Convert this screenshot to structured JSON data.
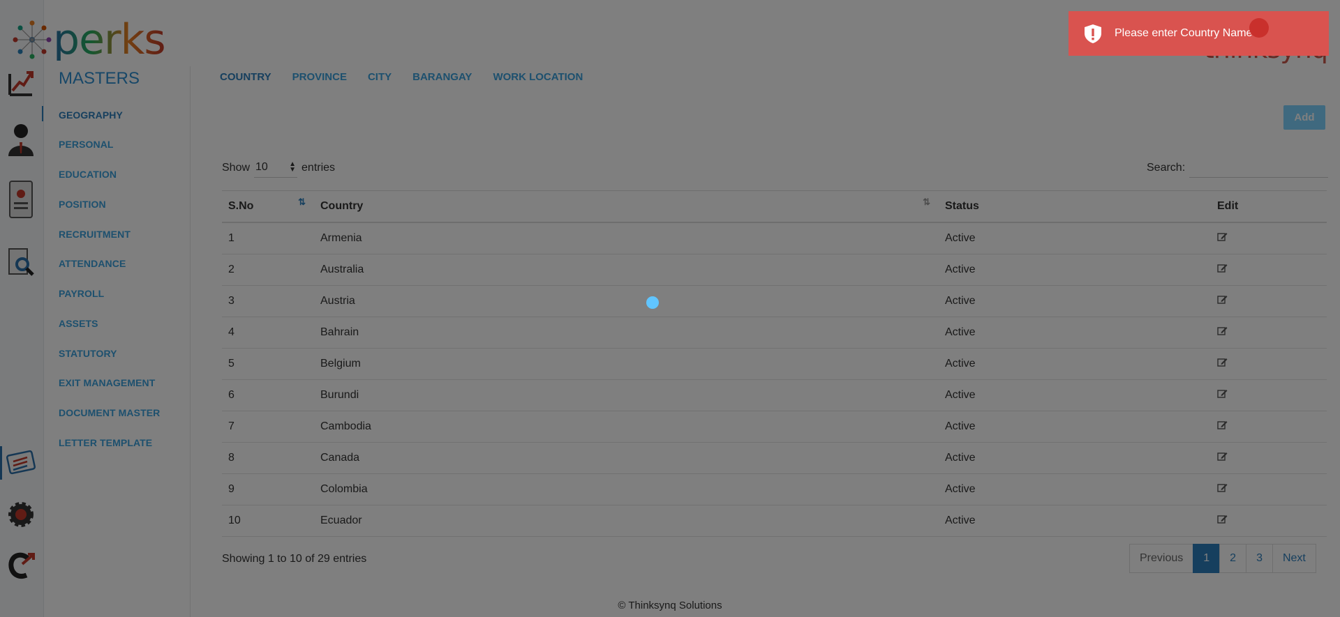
{
  "logo": {
    "text": "perks"
  },
  "brand": {
    "text": "thinksynq"
  },
  "rail": {
    "items": [
      {
        "name": "dashboard-chart"
      },
      {
        "name": "employee"
      },
      {
        "name": "profile-document"
      },
      {
        "name": "search-document"
      },
      {
        "name": "masters"
      },
      {
        "name": "settings"
      },
      {
        "name": "logout"
      }
    ]
  },
  "masters": {
    "title": "MASTERS",
    "items": [
      "GEOGRAPHY",
      "PERSONAL",
      "EDUCATION",
      "POSITION",
      "RECRUITMENT",
      "ATTENDANCE",
      "PAYROLL",
      "ASSETS",
      "STATUTORY",
      "EXIT MANAGEMENT",
      "DOCUMENT MASTER",
      "LETTER TEMPLATE"
    ],
    "active": "GEOGRAPHY"
  },
  "tabs": [
    "COUNTRY",
    "PROVINCE",
    "CITY",
    "BARANGAY",
    "WORK LOCATION"
  ],
  "active_tab": "COUNTRY",
  "add_label": "Add",
  "length": {
    "show": "Show",
    "value": "10",
    "entries": "entries"
  },
  "search": {
    "label": "Search:",
    "value": ""
  },
  "table": {
    "headers": [
      "S.No",
      "Country",
      "Status",
      "Edit"
    ],
    "rows": [
      [
        "1",
        "Armenia",
        "Active"
      ],
      [
        "2",
        "Australia",
        "Active"
      ],
      [
        "3",
        "Austria",
        "Active"
      ],
      [
        "4",
        "Bahrain",
        "Active"
      ],
      [
        "5",
        "Belgium",
        "Active"
      ],
      [
        "6",
        "Burundi",
        "Active"
      ],
      [
        "7",
        "Cambodia",
        "Active"
      ],
      [
        "8",
        "Canada",
        "Active"
      ],
      [
        "9",
        "Colombia",
        "Active"
      ],
      [
        "10",
        "Ecuador",
        "Active"
      ]
    ]
  },
  "info": "Showing 1 to 10 of 29 entries",
  "pagination": {
    "previous": "Previous",
    "pages": [
      "1",
      "2",
      "3"
    ],
    "active": "1",
    "next": "Next"
  },
  "copyright": "© Thinksynq Solutions",
  "toast": {
    "message": "Please enter Country Name"
  },
  "colors": {
    "accent": "#2d7fbd",
    "link": "#3aa0dd",
    "toast": "#d9534f",
    "add_button": "#7fd3ff"
  }
}
